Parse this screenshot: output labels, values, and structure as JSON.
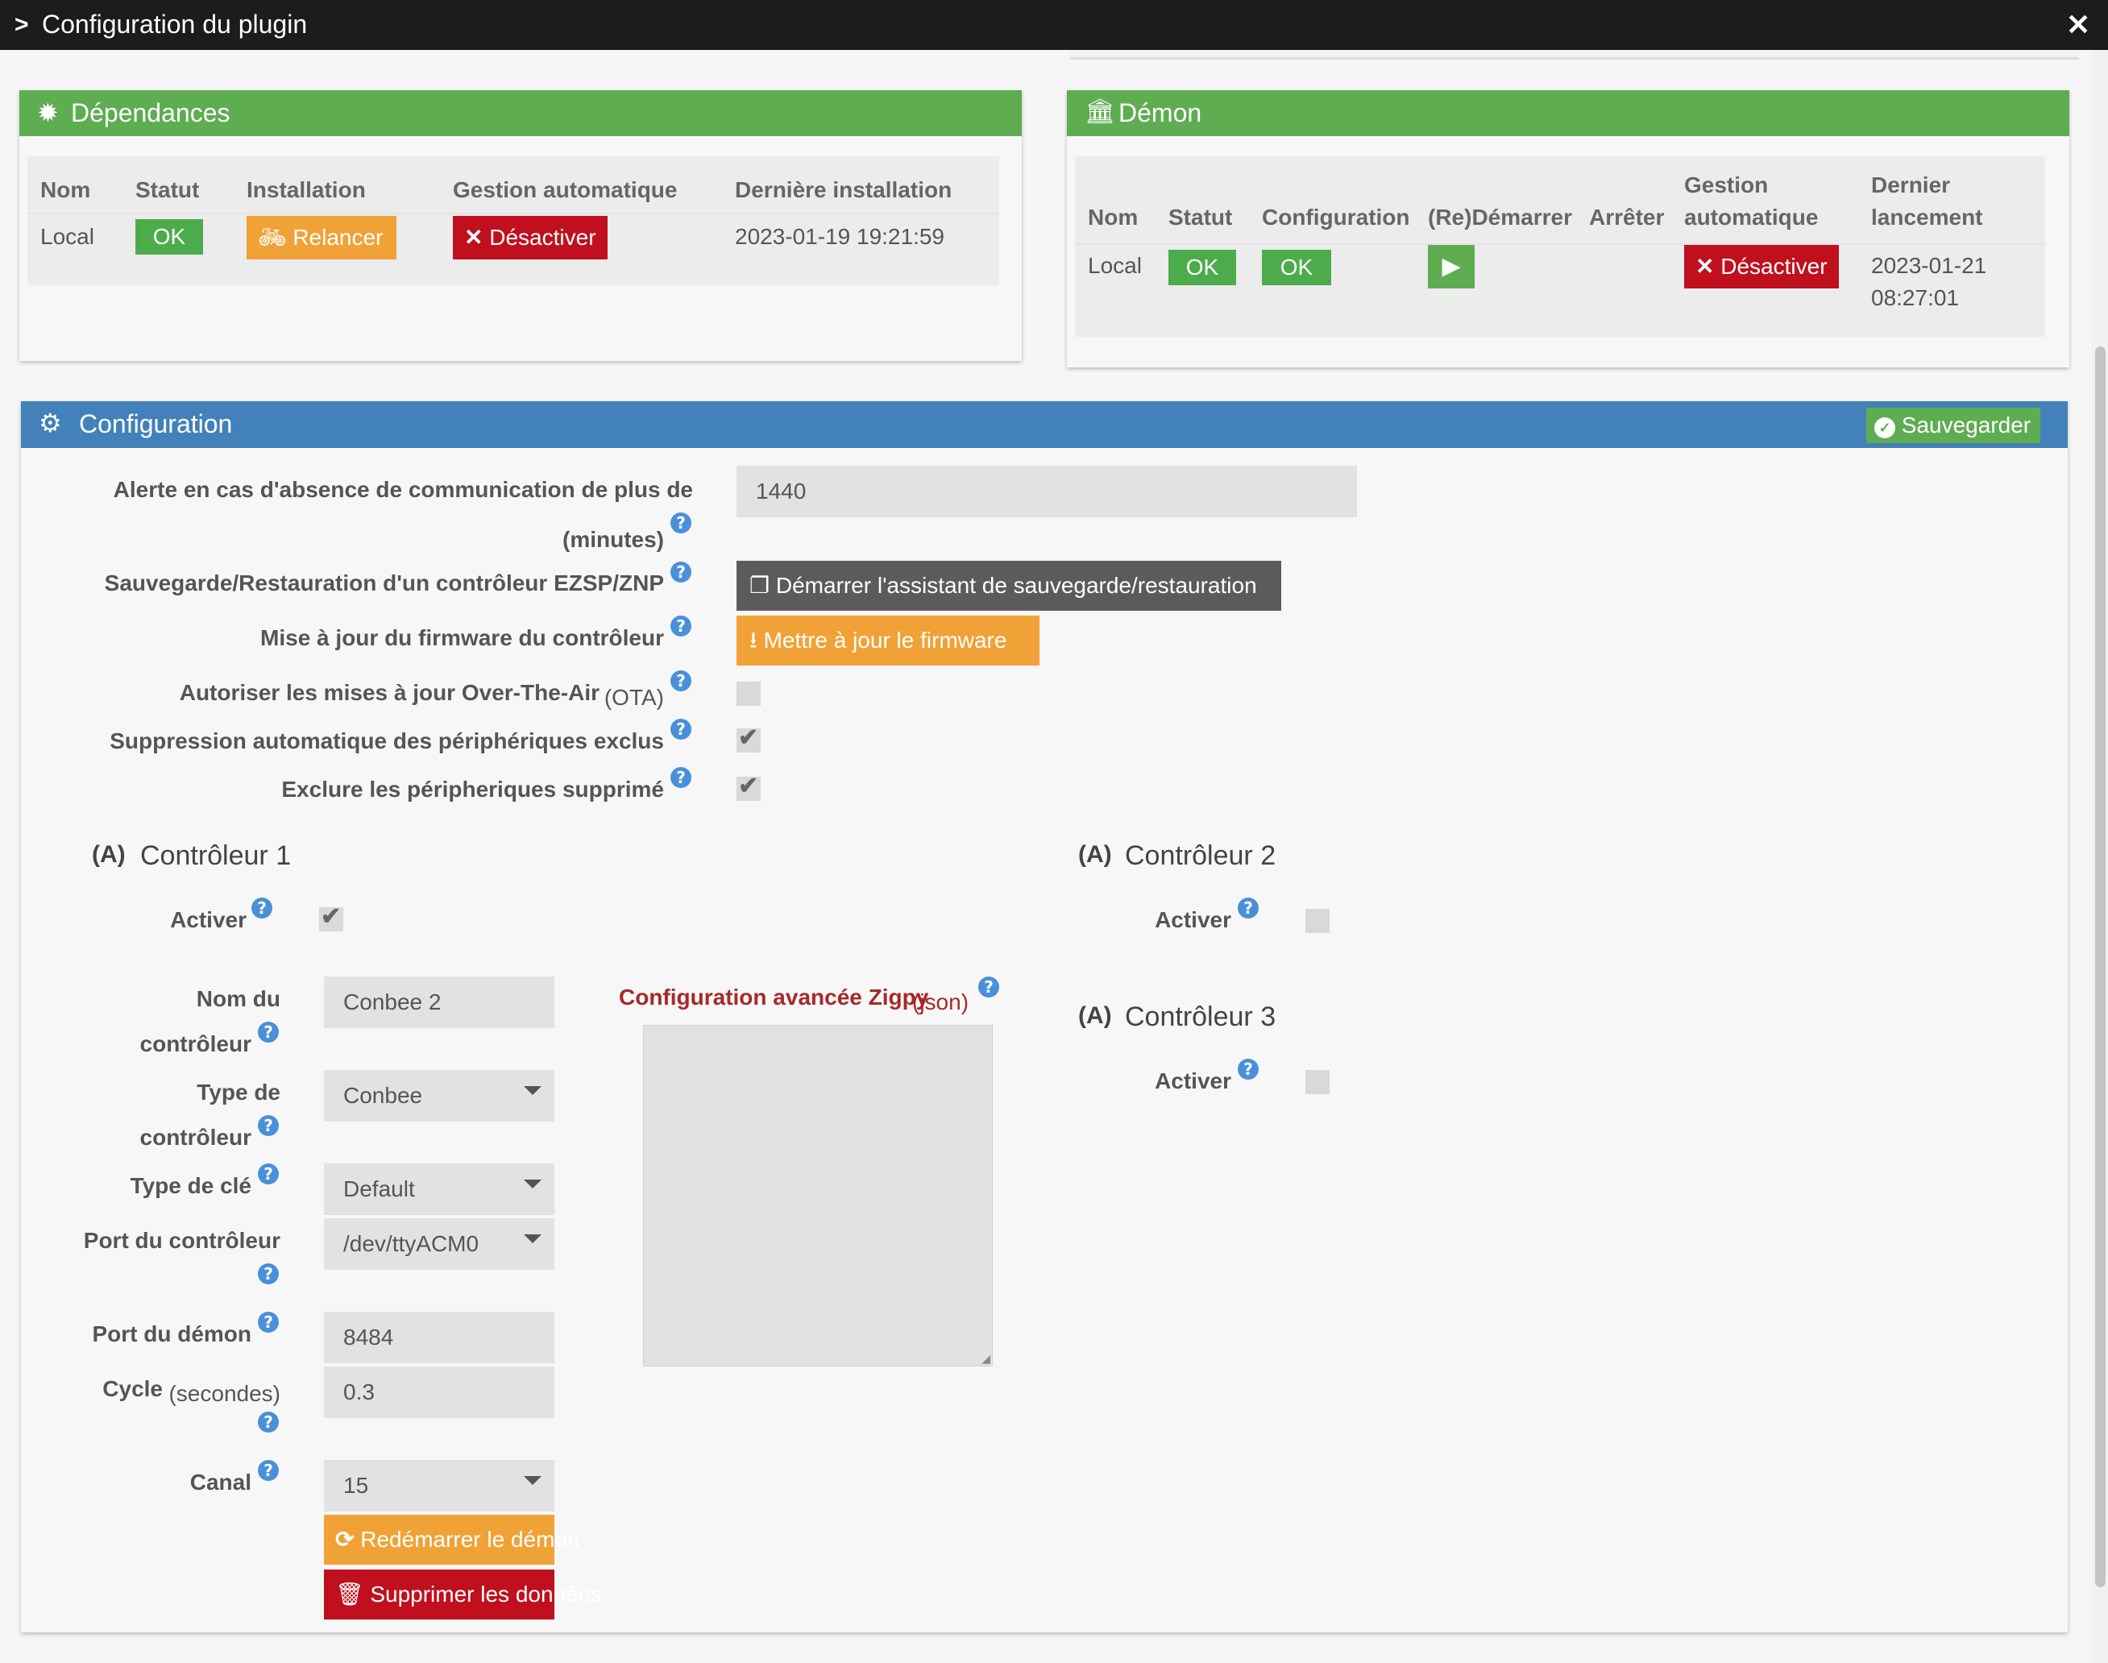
{
  "titlebar": {
    "title": "Configuration du plugin",
    "chevron": ">",
    "close": "✕"
  },
  "dependances": {
    "title": "Dépendances",
    "headers": [
      "Nom",
      "Statut",
      "Installation",
      "Gestion automatique",
      "Dernière installation"
    ],
    "row": {
      "nom": "Local",
      "statut": "OK",
      "installation": "Relancer",
      "gestion": "Désactiver",
      "derniere": "2023-01-19 19:21:59"
    }
  },
  "demon": {
    "title": "Démon",
    "headers": {
      "nom": "Nom",
      "statut": "Statut",
      "configuration": "Configuration",
      "redemarrer": "(Re)Démarrer",
      "arreter": "Arrêter",
      "gestion1": "Gestion",
      "gestion2": "automatique",
      "dernier1": "Dernier",
      "dernier2": "lancement"
    },
    "row": {
      "nom": "Local",
      "statut": "OK",
      "configuration": "OK",
      "gestion": "Désactiver",
      "date": "2023-01-21",
      "time": "08:27:01"
    }
  },
  "configuration": {
    "title": "Configuration",
    "save_label": "Sauvegarder",
    "alert_label_1": "Alerte en cas d'absence de communication de plus de",
    "alert_label_2": "(minutes)",
    "alert_value": "1440",
    "backup_label": "Sauvegarde/Restauration d'un contrôleur EZSP/ZNP",
    "backup_button": "Démarrer l'assistant de sauvegarde/restauration",
    "firmware_label": "Mise à jour du firmware du contrôleur",
    "firmware_button": "Mettre à jour le firmware",
    "ota_label": "Autoriser les mises à jour Over-The-Air",
    "ota_suffix": "(OTA)",
    "ota_checked": false,
    "auto_delete_label": "Suppression automatique des périphériques exclus",
    "auto_delete_checked": true,
    "exclude_label": "Exclure les péripheriques supprimé",
    "exclude_checked": true
  },
  "controleur1": {
    "title": "Contrôleur 1",
    "activer_label": "Activer",
    "activer_checked": true,
    "nom_label_1": "Nom du",
    "nom_label_2": "contrôleur",
    "nom_value": "Conbee 2",
    "type_label_1": "Type de",
    "type_label_2": "contrôleur",
    "type_value": "Conbee",
    "cle_label": "Type de clé",
    "cle_value": "Default",
    "port_label": "Port du contrôleur",
    "port_value": "/dev/ttyACM0",
    "port_demon_label": "Port du démon",
    "port_demon_value": "8484",
    "cycle_label": "Cycle",
    "cycle_suffix": "(secondes)",
    "cycle_value": "0.3",
    "canal_label": "Canal",
    "canal_value": "15",
    "restart_button": "Redémarrer le démon",
    "delete_button": "Supprimer les données",
    "zigpy_label": "Configuration avancée Zigpy",
    "zigpy_suffix": "(json)",
    "zigpy_value": ""
  },
  "controleur2": {
    "title": "Contrôleur 2",
    "activer_label": "Activer",
    "activer_checked": false
  },
  "controleur3": {
    "title": "Contrôleur 3",
    "activer_label": "Activer",
    "activer_checked": false
  },
  "icons": {
    "help": "?",
    "check": "✔",
    "antenna": "(A)",
    "play": "▶",
    "x": "✕"
  },
  "colors": {
    "green": "#5ead51",
    "blue": "#4281b9",
    "orange": "#f0a236",
    "red": "#c0101e",
    "dark": "#5b5b5b",
    "zigpy_label": "#a52a2a"
  }
}
